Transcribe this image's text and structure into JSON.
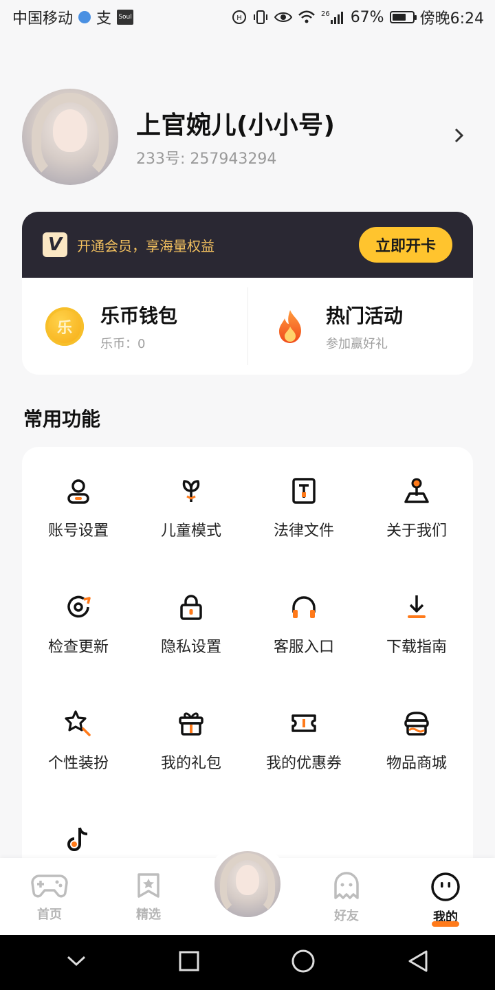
{
  "status_bar": {
    "carrier": "中国移动",
    "alipay": "支",
    "soul": "Soul",
    "network": "26",
    "battery": "67%",
    "battery_level": 0.67,
    "time": "傍晚6:24"
  },
  "profile": {
    "name": "上官婉儿(小小号)",
    "id_text": "233号: 257943294"
  },
  "vip": {
    "logo": "V",
    "promo_text": "开通会员，享海量权益",
    "button_label": "立即开卡",
    "wallet": {
      "icon_text": "乐",
      "title": "乐币钱包",
      "subtitle": "乐币：0"
    },
    "events": {
      "title": "热门活动",
      "subtitle": "参加赢好礼"
    }
  },
  "section": {
    "title": "常用功能"
  },
  "functions": [
    {
      "label": "账号设置",
      "icon": "user-icon"
    },
    {
      "label": "儿童模式",
      "icon": "sprout-icon"
    },
    {
      "label": "法律文件",
      "icon": "document-icon"
    },
    {
      "label": "关于我们",
      "icon": "joystick-icon"
    },
    {
      "label": "检查更新",
      "icon": "refresh-icon"
    },
    {
      "label": "隐私设置",
      "icon": "lock-icon"
    },
    {
      "label": "客服入口",
      "icon": "headphones-icon"
    },
    {
      "label": "下载指南",
      "icon": "download-icon"
    },
    {
      "label": "个性装扮",
      "icon": "star-wand-icon"
    },
    {
      "label": "我的礼包",
      "icon": "gift-icon"
    },
    {
      "label": "我的优惠券",
      "icon": "coupon-icon"
    },
    {
      "label": "物品商城",
      "icon": "shop-icon"
    },
    {
      "label": "",
      "icon": "tiktok-icon"
    }
  ],
  "bottom_nav": {
    "items": [
      {
        "label": "首页",
        "icon": "gamepad-icon"
      },
      {
        "label": "精选",
        "icon": "bookmark-star-icon"
      },
      {
        "label": "好友",
        "icon": "ghost-icon"
      },
      {
        "label": "我的",
        "icon": "face-icon"
      }
    ],
    "active_index": 3
  },
  "colors": {
    "accent": "#ff7a1a",
    "vip_bg": "#2a2833",
    "vip_text": "#f3c15f",
    "vip_button": "#ffc42e"
  }
}
